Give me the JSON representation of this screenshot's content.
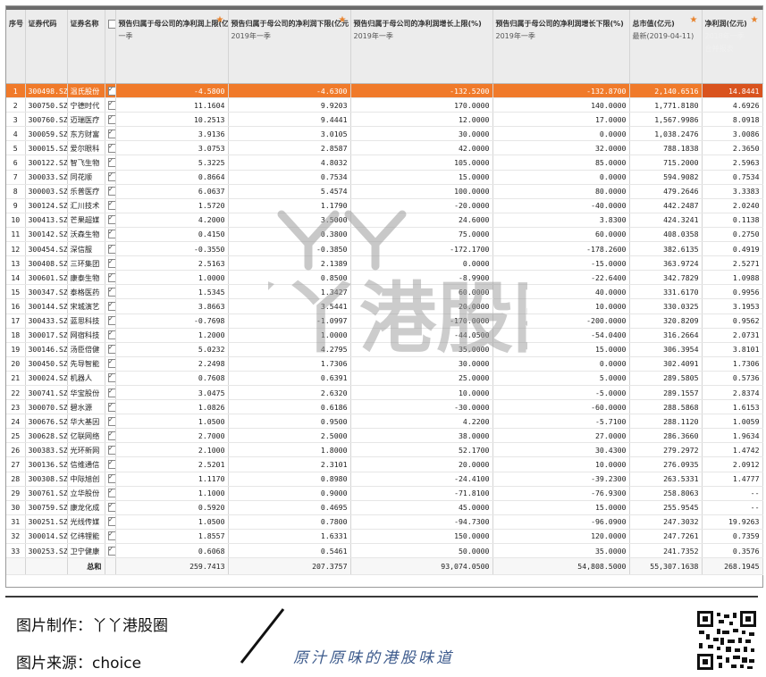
{
  "headers": {
    "idx": "序号",
    "code": "证券代码",
    "name": "证券名称",
    "col1": {
      "title": "预告归属于母公司的净利润上限(亿元)",
      "sub": "一季"
    },
    "col2": {
      "title": "预告归属于母公司的净利润下限(亿元",
      "sub": "2019年一季"
    },
    "col3": {
      "title": "预告归属于母公司的净利润增长上限(%)",
      "sub": "2019年一季"
    },
    "col4": {
      "title": "预告归属于母公司的净利润增长下限(%)",
      "sub": "2019年一季"
    },
    "col5": {
      "title": "总市值(亿元)",
      "sub": "最新(2019-04-11)"
    },
    "col6": {
      "title": "净利润(亿元)",
      "sub": "2018年一季",
      "sub2": "合并报表"
    }
  },
  "rows": [
    [
      "1",
      "300498.SZ",
      "温氏股份",
      "-4.5800",
      "-4.6300",
      "-132.5200",
      "-132.8700",
      "2,140.6516",
      "14.8441"
    ],
    [
      "2",
      "300750.SZ",
      "宁德时代",
      "11.1604",
      "9.9203",
      "170.0000",
      "140.0000",
      "1,771.8180",
      "4.6926"
    ],
    [
      "3",
      "300760.SZ",
      "迈瑞医疗",
      "10.2513",
      "9.4441",
      "12.0000",
      "17.0000",
      "1,567.9986",
      "8.0918"
    ],
    [
      "4",
      "300059.SZ",
      "东方财富",
      "3.9136",
      "3.0105",
      "30.0000",
      "0.0000",
      "1,038.2476",
      "3.0086"
    ],
    [
      "5",
      "300015.SZ",
      "爱尔眼科",
      "3.0753",
      "2.8587",
      "42.0000",
      "32.0000",
      "788.1838",
      "2.3650"
    ],
    [
      "6",
      "300122.SZ",
      "智飞生物",
      "5.3225",
      "4.8032",
      "105.0000",
      "85.0000",
      "715.2000",
      "2.5963"
    ],
    [
      "7",
      "300033.SZ",
      "同花顺",
      "0.8664",
      "0.7534",
      "15.0000",
      "0.0000",
      "594.9082",
      "0.7534"
    ],
    [
      "8",
      "300003.SZ",
      "乐普医疗",
      "6.0637",
      "5.4574",
      "100.0000",
      "80.0000",
      "479.2646",
      "3.3383"
    ],
    [
      "9",
      "300124.SZ",
      "汇川技术",
      "1.5720",
      "1.1790",
      "-20.0000",
      "-40.0000",
      "442.2487",
      "2.0240"
    ],
    [
      "10",
      "300413.SZ",
      "芒果超媒",
      "4.2000",
      "3.5000",
      "24.6000",
      "3.8300",
      "424.3241",
      "0.1138"
    ],
    [
      "11",
      "300142.SZ",
      "沃森生物",
      "0.4150",
      "0.3800",
      "75.0000",
      "60.0000",
      "408.0358",
      "0.2750"
    ],
    [
      "12",
      "300454.SZ",
      "深信服",
      "-0.3550",
      "-0.3850",
      "-172.1700",
      "-178.2600",
      "382.6135",
      "0.4919"
    ],
    [
      "13",
      "300408.SZ",
      "三环集团",
      "2.5163",
      "2.1389",
      "0.0000",
      "-15.0000",
      "363.9724",
      "2.5271"
    ],
    [
      "14",
      "300601.SZ",
      "康泰生物",
      "1.0000",
      "0.8500",
      "-8.9900",
      "-22.6400",
      "342.7829",
      "1.0988"
    ],
    [
      "15",
      "300347.SZ",
      "泰格医药",
      "1.5345",
      "1.3427",
      "60.0000",
      "40.0000",
      "331.6170",
      "0.9956"
    ],
    [
      "16",
      "300144.SZ",
      "宋城演艺",
      "3.8663",
      "3.5441",
      "20.0000",
      "10.0000",
      "330.0325",
      "3.1953"
    ],
    [
      "17",
      "300433.SZ",
      "蓝思科技",
      "-0.7698",
      "-1.0997",
      "-170.0000",
      "-200.0000",
      "320.8209",
      "0.9562"
    ],
    [
      "18",
      "300017.SZ",
      "网宿科技",
      "1.2000",
      "1.0000",
      "-44.0500",
      "-54.0400",
      "316.2664",
      "2.0731"
    ],
    [
      "19",
      "300146.SZ",
      "汤臣倍健",
      "5.0232",
      "4.2795",
      "35.0000",
      "15.0000",
      "306.3954",
      "3.8101"
    ],
    [
      "20",
      "300450.SZ",
      "先导智能",
      "2.2498",
      "1.7306",
      "30.0000",
      "0.0000",
      "302.4091",
      "1.7306"
    ],
    [
      "21",
      "300024.SZ",
      "机器人",
      "0.7608",
      "0.6391",
      "25.0000",
      "5.0000",
      "289.5805",
      "0.5736"
    ],
    [
      "22",
      "300741.SZ",
      "华宝股份",
      "3.0475",
      "2.6320",
      "10.0000",
      "-5.0000",
      "289.1557",
      "2.8374"
    ],
    [
      "23",
      "300070.SZ",
      "碧水源",
      "1.0826",
      "0.6186",
      "-30.0000",
      "-60.0000",
      "288.5868",
      "1.6153"
    ],
    [
      "24",
      "300676.SZ",
      "华大基因",
      "1.0500",
      "0.9500",
      "4.2200",
      "-5.7100",
      "288.1120",
      "1.0059"
    ],
    [
      "25",
      "300628.SZ",
      "亿联网络",
      "2.7000",
      "2.5000",
      "38.0000",
      "27.0000",
      "286.3660",
      "1.9634"
    ],
    [
      "26",
      "300383.SZ",
      "光环新网",
      "2.1000",
      "1.8000",
      "52.1700",
      "30.4300",
      "279.2972",
      "1.4742"
    ],
    [
      "27",
      "300136.SZ",
      "信维通信",
      "2.5201",
      "2.3101",
      "20.0000",
      "10.0000",
      "276.0935",
      "2.0912"
    ],
    [
      "28",
      "300308.SZ",
      "中际旭创",
      "1.1170",
      "0.8980",
      "-24.4100",
      "-39.2300",
      "263.5331",
      "1.4777"
    ],
    [
      "29",
      "300761.SZ",
      "立华股份",
      "1.1000",
      "0.9000",
      "-71.8100",
      "-76.9300",
      "258.8063",
      "--"
    ],
    [
      "30",
      "300759.SZ",
      "康龙化成",
      "0.5920",
      "0.4695",
      "45.0000",
      "15.0000",
      "255.9545",
      "--"
    ],
    [
      "31",
      "300251.SZ",
      "光线传媒",
      "1.0500",
      "0.7800",
      "-94.7300",
      "-96.0900",
      "247.3032",
      "19.9263"
    ],
    [
      "32",
      "300014.SZ",
      "亿纬锂能",
      "1.8557",
      "1.6331",
      "150.0000",
      "120.0000",
      "247.7261",
      "0.7359"
    ],
    [
      "33",
      "300253.SZ",
      "卫宁健康",
      "0.6068",
      "0.5461",
      "50.0000",
      "35.0000",
      "241.7352",
      "0.3576"
    ]
  ],
  "totals": {
    "label": "总和",
    "c1": "259.7413",
    "c2": "207.3757",
    "c3": "93,074.0500",
    "c4": "54,808.5000",
    "c5": "55,307.1638",
    "c6": "268.1945"
  },
  "watermark": "丫丫港股圈",
  "footer": {
    "maker": "图片制作：丫丫港股圈",
    "source": "图片来源：choice",
    "slogan": "原汁原味的港股味道"
  },
  "colors": {
    "accent": "#f07a2a",
    "header": "#ececec",
    "slogan": "#3c5a8c"
  }
}
